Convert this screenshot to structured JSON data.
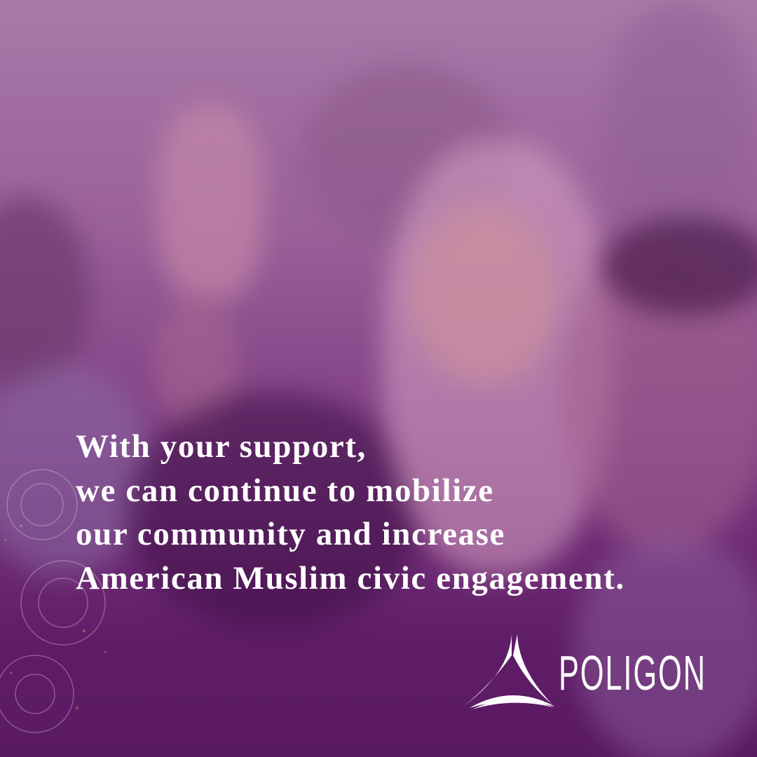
{
  "headline": {
    "lines": [
      "With your support,",
      "we can continue to mobilize",
      "our community and increase",
      "American Muslim civic engagement."
    ]
  },
  "logo": {
    "text": "POLIGON",
    "icon": "triangle-swoosh-logo"
  },
  "colors": {
    "overlay": "#7d3b82",
    "dark_purple": "#5a1a62",
    "text": "#ffffff"
  }
}
